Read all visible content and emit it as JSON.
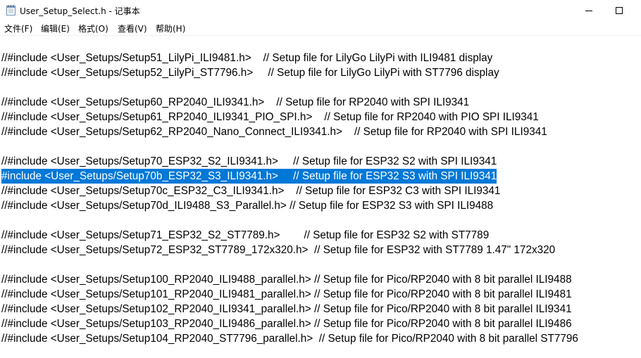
{
  "window": {
    "title": "User_Setup_Select.h - 记事本"
  },
  "icons": {
    "app": "notepad-icon",
    "minimize": "minimize-icon",
    "maximize": "maximize-icon"
  },
  "menu": {
    "file": "文件(F)",
    "edit": "编辑(E)",
    "format": "格式(O)",
    "view": "查看(V)",
    "help": "帮助(H)"
  },
  "colors": {
    "selection": "#0078d7",
    "selected_text": "#ffffff"
  },
  "lines": [
    "//#include <User_Setups/Setup51_LilyPi_ILI9481.h>    // Setup file for LilyGo LilyPi with ILI9481 display",
    "//#include <User_Setups/Setup52_LilyPi_ST7796.h>     // Setup file for LilyGo LilyPi with ST7796 display",
    "//#include <User_Setups/Setup60_RP2040_ILI9341.h>    // Setup file for RP2040 with SPI ILI9341",
    "//#include <User_Setups/Setup61_RP2040_ILI9341_PIO_SPI.h>    // Setup file for RP2040 with PIO SPI ILI9341",
    "//#include <User_Setups/Setup62_RP2040_Nano_Connect_ILI9341.h>    // Setup file for RP2040 with SPI ILI9341",
    "//#include <User_Setups/Setup70_ESP32_S2_ILI9341.h>     // Setup file for ESP32 S2 with SPI ILI9341",
    "#include <User_Setups/Setup70b_ESP32_S3_ILI9341.h>     // Setup file for ESP32 S3 with SPI ILI9341",
    "//#include <User_Setups/Setup70c_ESP32_C3_ILI9341.h>    // Setup file for ESP32 C3 with SPI ILI9341",
    "//#include <User_Setups/Setup70d_ILI9488_S3_Parallel.h> // Setup file for ESP32 S3 with SPI ILI9488",
    "//#include <User_Setups/Setup71_ESP32_S2_ST7789.h>        // Setup file for ESP32 S2 with ST7789",
    "//#include <User_Setups/Setup72_ESP32_ST7789_172x320.h>  // Setup file for ESP32 with ST7789 1.47\" 172x320",
    "//#include <User_Setups/Setup100_RP2040_ILI9488_parallel.h> // Setup file for Pico/RP2040 with 8 bit parallel ILI9488",
    "//#include <User_Setups/Setup101_RP2040_ILI9481_parallel.h> // Setup file for Pico/RP2040 with 8 bit parallel ILI9481",
    "//#include <User_Setups/Setup102_RP2040_ILI9341_parallel.h> // Setup file for Pico/RP2040 with 8 bit parallel ILI9341",
    "//#include <User_Setups/Setup103_RP2040_ILI9486_parallel.h> // Setup file for Pico/RP2040 with 8 bit parallel ILI9486",
    "//#include <User_Setups/Setup104_RP2040_ST7796_parallel.h>  // Setup file for Pico/RP2040 with 8 bit parallel ST7796"
  ]
}
